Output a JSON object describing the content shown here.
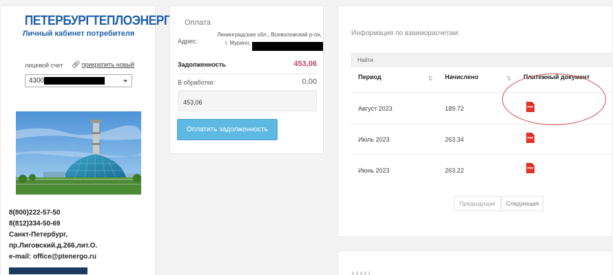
{
  "sidebar": {
    "brand_name": "ПЕТЕРБУРГТЕПЛОЭНЕРГО",
    "brand_subtitle": "Личный кабинет потребителя",
    "account_label": "лицевой счет",
    "attach_link": "прикрепить новый",
    "account_value": "4300",
    "contacts": [
      "8(800)222-57-50",
      "8(812)334-50-69",
      "Санкт-Петербург,",
      "пр.Лиговский.д.266,лит.О.",
      "e-mail: office@ptenergo.ru"
    ]
  },
  "payment": {
    "title": "Оплата",
    "address_label": "Адрес:",
    "address_line1": "Ленинградская обл., Всеволожский р-он,",
    "address_line2": "г. Мурино,",
    "debt_label": "Задолженность",
    "debt_value": "453,06",
    "processing_label": "В обработке:",
    "processing_value": "0,00",
    "amount_input_value": "453,06",
    "pay_button": "Оплатить задолженность"
  },
  "settlements": {
    "title": "Информация по взаиморасчетам:",
    "search_placeholder": "Найти",
    "columns": [
      "Период",
      "Начислено",
      "Платежный документ"
    ],
    "rows": [
      {
        "period": "Август 2023",
        "charged": "189.72",
        "doc": "PDF"
      },
      {
        "period": "Июль 2023",
        "charged": "263.34",
        "doc": "PDF"
      },
      {
        "period": "Июнь 2023",
        "charged": "263.22",
        "doc": "PDF"
      }
    ],
    "prev_label": "Предыдущая",
    "next_label": "Следующая"
  },
  "colors": {
    "brand": "#1f5fa8",
    "debt": "#c0446a",
    "pay_button": "#5db8e2",
    "pdf_red": "#e23326",
    "highlight": "#d14a4a"
  }
}
